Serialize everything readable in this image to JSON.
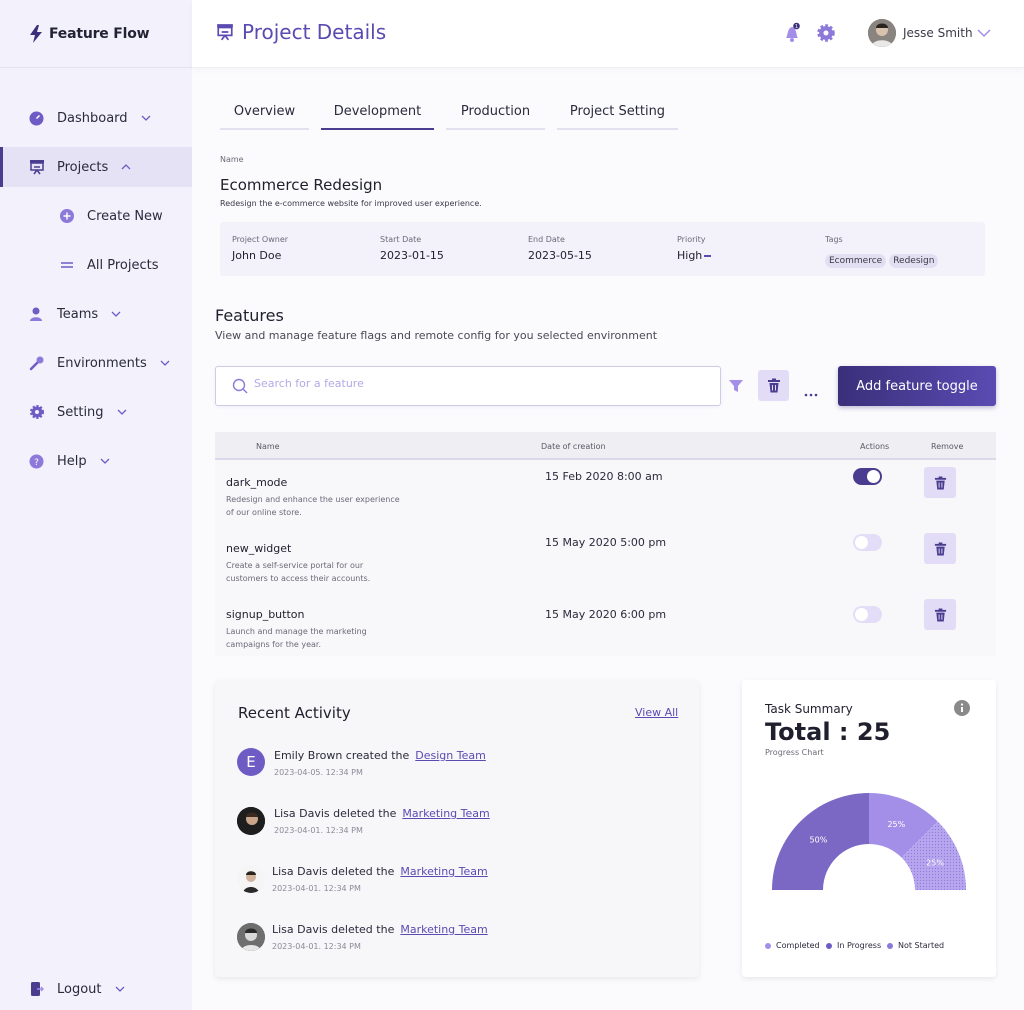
{
  "app": {
    "name": "Feature Flow"
  },
  "sidebar": {
    "items": [
      {
        "label": "Dashboard"
      },
      {
        "label": "Projects"
      },
      {
        "label": "Create New"
      },
      {
        "label": "All Projects"
      },
      {
        "label": "Teams"
      },
      {
        "label": "Environments"
      },
      {
        "label": "Setting"
      },
      {
        "label": "Help"
      },
      {
        "label": "Logout"
      }
    ]
  },
  "header": {
    "title": "Project Details",
    "user_name": "Jesse Smith",
    "notification_count": "1"
  },
  "tabs": [
    {
      "label": "Overview"
    },
    {
      "label": "Development"
    },
    {
      "label": "Production"
    },
    {
      "label": "Project Setting"
    }
  ],
  "project": {
    "name_label": "Name",
    "name": "Ecommerce Redesign",
    "description": "Redesign the e-commerce website for improved user experience.",
    "owner_label": "Project Owner",
    "owner": "John Doe",
    "start_label": "Start Date",
    "start": "2023-01-15",
    "end_label": "End Date",
    "end": "2023-05-15",
    "priority_label": "Priority",
    "priority": "High",
    "tags_label": "Tags",
    "tags": [
      "Ecommerce",
      "Redesign"
    ]
  },
  "features": {
    "title": "Features",
    "subtitle": "View and manage feature flags and remote config for you selected environment",
    "search_placeholder": "Search for a feature",
    "add_button": "Add feature toggle",
    "columns": {
      "name": "Name",
      "date": "Date of creation",
      "actions": "Actions",
      "remove": "Remove"
    },
    "rows": [
      {
        "name": "dark_mode",
        "desc1": "Redesign and enhance the user experience",
        "desc2": "of our online store.",
        "date": "15 Feb 2020 8:00 am",
        "enabled": true
      },
      {
        "name": "new_widget",
        "desc1": "Create a self-service portal for our",
        "desc2": "customers to access their accounts.",
        "date": "15 May 2020 5:00 pm",
        "enabled": false
      },
      {
        "name": "signup_button",
        "desc1": "Launch and manage the marketing",
        "desc2": "campaigns for the year.",
        "date": "15 May 2020 6:00 pm",
        "enabled": false
      }
    ]
  },
  "activity": {
    "title": "Recent Activity",
    "view_all": "View All",
    "items": [
      {
        "initial": "E",
        "text": "Emily Brown created the",
        "link": "Design Team",
        "time": "2023-04-05. 12:34 PM"
      },
      {
        "text": "Lisa Davis deleted the",
        "link": "Marketing Team",
        "time": "2023-04-01. 12:34 PM"
      },
      {
        "text": "Lisa Davis deleted the",
        "link": "Marketing Team",
        "time": "2023-04-01. 12:34 PM"
      },
      {
        "text": "Lisa Davis deleted the",
        "link": "Marketing Team",
        "time": "2023-04-01. 12:34 PM"
      }
    ]
  },
  "task_summary": {
    "label": "Task Summary",
    "total": "Total : 25",
    "subtitle": "Progress Chart",
    "slices": [
      {
        "name": "Completed",
        "label": "50%",
        "value": 50,
        "color": "#7b68c4"
      },
      {
        "name": "In Progress",
        "label": "25%",
        "value": 25,
        "color": "#a48fe8"
      },
      {
        "name": "Not Started",
        "label": "25%",
        "value": 25,
        "color": "#b7a6ee"
      }
    ],
    "legend": [
      "Completed",
      "In Progress",
      "Not Started"
    ]
  },
  "colors": {
    "accent": "#5a4bb3",
    "accent_dark": "#3a2f7a",
    "sidebar_bg": "#f3f1fb"
  }
}
